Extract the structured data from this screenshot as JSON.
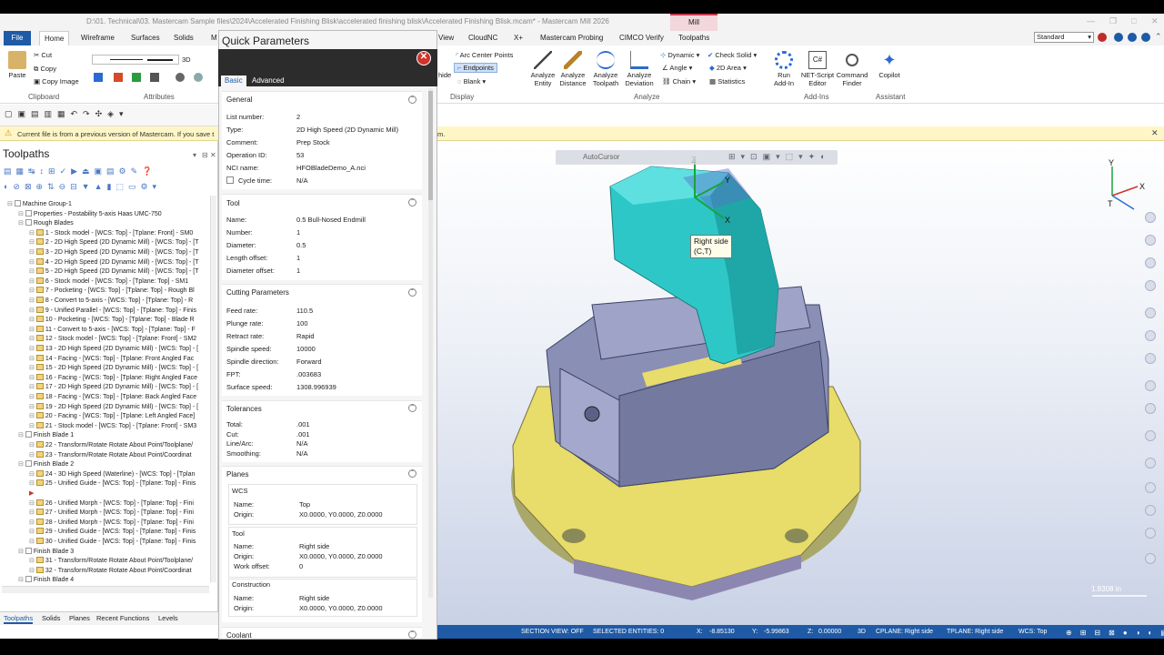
{
  "window": {
    "title": "D:\\01. Technical\\03. Mastercam Sample files\\2024\\Accelerated Finishing Blisk\\accelerated finishing blisk\\Accelerated Finishing Blisk.mcam* - Mastercam Mill 2026",
    "context_tab": "Mill"
  },
  "ribbon_tabs": [
    "File",
    "Home",
    "Wireframe",
    "Surfaces",
    "Solids",
    "M",
    "View",
    "CloudNC",
    "X+",
    "Mastercam Probing",
    "CIMCO Verify",
    "Toolpaths"
  ],
  "ribbon": {
    "clipboard": {
      "label": "Clipboard",
      "paste": "Paste",
      "cut": "Cut",
      "copy": "Copy",
      "copy_image": "Copy Image"
    },
    "attributes": {
      "label": "Attributes",
      "dim": "3D"
    },
    "display": {
      "label": "Display",
      "arc_center": "Arc Center Points",
      "endpoints": "Endpoints",
      "blank": "Blank",
      "hide": "hide"
    },
    "analyze": {
      "label": "Analyze",
      "entity": "Analyze\nEntity",
      "distance": "Analyze\nDistance",
      "toolpath": "Analyze\nToolpath",
      "deviation": "Analyze\nDeviation",
      "dynamic": "Dynamic",
      "angle": "Angle",
      "chain": "Chain",
      "check_solid": "Check Solid",
      "area": "2D Area",
      "statistics": "Statistics"
    },
    "addins": {
      "label": "Add-Ins",
      "run": "Run\nAdd-In",
      "net": "NET-Script\nEditor",
      "cmd": "Command\nFinder"
    },
    "assistant": {
      "label": "Assistant",
      "copilot": "Copilot"
    },
    "standard": "Standard"
  },
  "notice": {
    "text": "Current file is from a previous version of Mastercam. If you save t",
    "tail": "m."
  },
  "toolpaths": {
    "title": "Toolpaths",
    "items": [
      {
        "text": "Machine Group-1",
        "indent": 0,
        "kind": "root"
      },
      {
        "text": "Properties - Postability 5-axis Haas UMC-750",
        "indent": 1,
        "kind": "prop"
      },
      {
        "text": "Rough Blades",
        "indent": 1,
        "kind": "group"
      },
      {
        "text": "1 - Stock model - [WCS: Top] - [Tplane: Front] - SM0",
        "indent": 2,
        "kind": "op"
      },
      {
        "text": "2 - 2D High Speed (2D Dynamic Mill) - [WCS: Top] - [T",
        "indent": 2,
        "kind": "op"
      },
      {
        "text": "3 - 2D High Speed (2D Dynamic Mill) - [WCS: Top] - [T",
        "indent": 2,
        "kind": "op"
      },
      {
        "text": "4 - 2D High Speed (2D Dynamic Mill) - [WCS: Top] - [T",
        "indent": 2,
        "kind": "op"
      },
      {
        "text": "5 - 2D High Speed (2D Dynamic Mill) - [WCS: Top] - [T",
        "indent": 2,
        "kind": "op"
      },
      {
        "text": "6 - Stock model - [WCS: Top] - [Tplane: Top] - SM1",
        "indent": 2,
        "kind": "op"
      },
      {
        "text": "7 - Pocketing - [WCS: Top] - [Tplane: Top] - Rough Bl",
        "indent": 2,
        "kind": "op"
      },
      {
        "text": "8 - Convert to 5-axis - [WCS: Top] - [Tplane: Top] - R",
        "indent": 2,
        "kind": "op"
      },
      {
        "text": "9 - Unified Parallel - [WCS: Top] - [Tplane: Top] - Finis",
        "indent": 2,
        "kind": "op"
      },
      {
        "text": "10 - Pocketing - [WCS: Top] - [Tplane: Top] - Blade R",
        "indent": 2,
        "kind": "op"
      },
      {
        "text": "11 - Convert to 5-axis - [WCS: Top] - [Tplane: Top] - F",
        "indent": 2,
        "kind": "op"
      },
      {
        "text": "12 - Stock model - [WCS: Top] - [Tplane: Front] - SM2",
        "indent": 2,
        "kind": "op"
      },
      {
        "text": "13 - 2D High Speed (2D Dynamic Mill) - [WCS: Top] - [",
        "indent": 2,
        "kind": "op"
      },
      {
        "text": "14 - Facing - [WCS: Top] - [Tplane: Front Angled Fac",
        "indent": 2,
        "kind": "op"
      },
      {
        "text": "15 - 2D High Speed (2D Dynamic Mill) - [WCS: Top] - [",
        "indent": 2,
        "kind": "op"
      },
      {
        "text": "16 - Facing - [WCS: Top] - [Tplane: Right Angled Face",
        "indent": 2,
        "kind": "op"
      },
      {
        "text": "17 - 2D High Speed (2D Dynamic Mill) - [WCS: Top] - [",
        "indent": 2,
        "kind": "op"
      },
      {
        "text": "18 - Facing - [WCS: Top] - [Tplane: Back Angled Face",
        "indent": 2,
        "kind": "op"
      },
      {
        "text": "19 - 2D High Speed (2D Dynamic Mill) - [WCS: Top] - [",
        "indent": 2,
        "kind": "op"
      },
      {
        "text": "20 - Facing - [WCS: Top] - [Tplane: Left Angled Face]",
        "indent": 2,
        "kind": "op"
      },
      {
        "text": "21 - Stock model - [WCS: Top] - [Tplane: Front] - SM3",
        "indent": 2,
        "kind": "op"
      },
      {
        "text": "Finish Blade 1",
        "indent": 1,
        "kind": "group"
      },
      {
        "text": "22 - Transform/Rotate Rotate About Point/Toolplane/",
        "indent": 2,
        "kind": "op"
      },
      {
        "text": "23 - Transform/Rotate Rotate About Point/Coordinat",
        "indent": 2,
        "kind": "op"
      },
      {
        "text": "Finish Blade 2",
        "indent": 1,
        "kind": "group"
      },
      {
        "text": "24 - 3D High Speed (Waterline) - [WCS: Top] - [Tplan",
        "indent": 2,
        "kind": "op"
      },
      {
        "text": "25 - Unified Guide - [WCS: Top] - [Tplane: Top] - Finis",
        "indent": 2,
        "kind": "op"
      },
      {
        "text": "",
        "indent": 2,
        "kind": "marker"
      },
      {
        "text": "26 - Unified Morph - [WCS: Top] - [Tplane: Top] - Fini",
        "indent": 2,
        "kind": "op"
      },
      {
        "text": "27 - Unified Morph - [WCS: Top] - [Tplane: Top] - Fini",
        "indent": 2,
        "kind": "op"
      },
      {
        "text": "28 - Unified Morph - [WCS: Top] - [Tplane: Top] - Fini",
        "indent": 2,
        "kind": "op"
      },
      {
        "text": "29 - Unified Guide - [WCS: Top] - [Tplane: Top] - Finis",
        "indent": 2,
        "kind": "op"
      },
      {
        "text": "30 - Unified Guide - [WCS: Top] - [Tplane: Top] - Finis",
        "indent": 2,
        "kind": "op"
      },
      {
        "text": "Finish Blade 3",
        "indent": 1,
        "kind": "group"
      },
      {
        "text": "31 - Transform/Rotate Rotate About Point/Toolplane/",
        "indent": 2,
        "kind": "op"
      },
      {
        "text": "32 - Transform/Rotate Rotate About Point/Coordinat",
        "indent": 2,
        "kind": "op"
      },
      {
        "text": "Finish Blade 4",
        "indent": 1,
        "kind": "group"
      }
    ]
  },
  "bottom_tabs": [
    "Toolpaths",
    "Solids",
    "Planes",
    "Recent Functions",
    "Levels"
  ],
  "quick_params": {
    "title": "Quick Parameters",
    "tabs": [
      "Basic",
      "Advanced"
    ],
    "general": {
      "head": "General",
      "rows": [
        [
          "List number:",
          "2"
        ],
        [
          "Type:",
          "2D High Speed (2D Dynamic Mill)"
        ],
        [
          "Comment:",
          "Prep Stock"
        ],
        [
          "Operation ID:",
          "53"
        ],
        [
          "NCI name:",
          "HFOBladeDemo_A.nci"
        ],
        [
          "Cycle time:",
          "N/A"
        ]
      ]
    },
    "tool": {
      "head": "Tool",
      "rows": [
        [
          "Name:",
          "0.5 Bull-Nosed Endmill"
        ],
        [
          "Number:",
          "1"
        ],
        [
          "Diameter:",
          "0.5"
        ],
        [
          "Length offset:",
          "1"
        ],
        [
          "Diameter offset:",
          "1"
        ]
      ]
    },
    "cutting": {
      "head": "Cutting Parameters",
      "rows": [
        [
          "Feed rate:",
          "110.5"
        ],
        [
          "Plunge rate:",
          "100"
        ],
        [
          "Retract rate:",
          "Rapid"
        ],
        [
          "Spindle speed:",
          "10000"
        ],
        [
          "Spindle direction:",
          "Forward"
        ],
        [
          "FPT:",
          ".003683"
        ],
        [
          "Surface speed:",
          "1308.996939"
        ]
      ]
    },
    "tolerances": {
      "head": "Tolerances",
      "rows": [
        [
          "Total:",
          ".001"
        ],
        [
          "Cut:",
          ".001"
        ],
        [
          "Line/Arc:",
          "N/A"
        ],
        [
          "Smoothing:",
          "N/A"
        ]
      ]
    },
    "planes": {
      "head": "Planes",
      "wcs": {
        "head": "WCS",
        "name_label": "Name:",
        "name": "Top",
        "origin_label": "Origin:",
        "origin": "X0.0000, Y0.0000, Z0.0000"
      },
      "tool": {
        "head": "Tool",
        "name_label": "Name:",
        "name": "Right side",
        "origin_label": "Origin:",
        "origin": "X0.0000, Y0.0000, Z0.0000",
        "offset_label": "Work offset:",
        "offset": "0"
      },
      "construction": {
        "head": "Construction",
        "name_label": "Name:",
        "name": "Right side",
        "origin_label": "Origin:",
        "origin": "X0.0000, Y0.0000, Z0.0000"
      }
    },
    "coolant": {
      "head": "Coolant"
    }
  },
  "viewport": {
    "tooltip": "Right side\n(C,T)",
    "autocursor": "AutoCursor",
    "scale": "1.8308 in",
    "axis_labels": {
      "x": "X",
      "y": "Y",
      "z": "Z"
    }
  },
  "status": {
    "section_view": "SECTION VIEW: OFF",
    "selected": "SELECTED ENTITIES: 0",
    "x_label": "X:",
    "x": "-8.85130",
    "y_label": "Y:",
    "y": "-5.99863",
    "z_label": "Z:",
    "z": "0.00000",
    "mode": "3D",
    "cplane": "CPLANE: Right side",
    "tplane": "TPLANE: Right side",
    "wcs": "WCS: Top"
  },
  "colors": {
    "accent": "#1f5aa6",
    "blade": "#2ec7c7",
    "vise": "#8a8fb5",
    "base": "#e8dc6a",
    "notice": "#fff6c8",
    "close": "#d0332b"
  }
}
